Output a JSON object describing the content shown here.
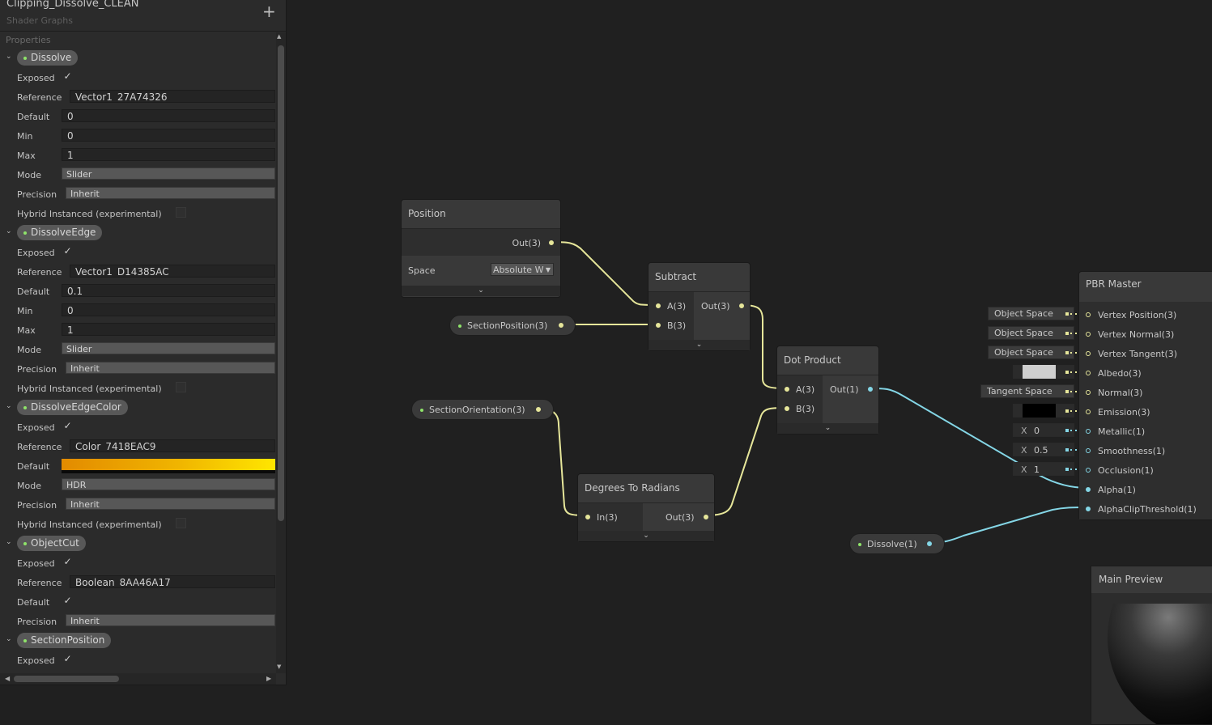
{
  "blackboard": {
    "title": "Clipping_Dissolve_CLEAN",
    "subtitle": "Shader Graphs",
    "add_label": "+",
    "properties_label": "Properties",
    "properties": [
      {
        "name": "Dissolve",
        "rows": [
          {
            "label": "Exposed",
            "kind": "check",
            "value": "✓"
          },
          {
            "label": "Reference",
            "kind": "field-indent",
            "value": "Vector1_27A74326"
          },
          {
            "label": "Default",
            "kind": "field",
            "value": "0"
          },
          {
            "label": "Min",
            "kind": "field",
            "value": "0"
          },
          {
            "label": "Max",
            "kind": "field",
            "value": "1"
          },
          {
            "label": "Mode",
            "kind": "drop",
            "value": "Slider"
          },
          {
            "label": "Precision",
            "kind": "drop-indent",
            "value": "Inherit"
          },
          {
            "label": "Hybrid Instanced (experimental)",
            "kind": "check-empty",
            "value": ""
          }
        ]
      },
      {
        "name": "DissolveEdge",
        "rows": [
          {
            "label": "Exposed",
            "kind": "check",
            "value": "✓"
          },
          {
            "label": "Reference",
            "kind": "field-indent",
            "value": "Vector1_D14385AC"
          },
          {
            "label": "Default",
            "kind": "field",
            "value": "0.1"
          },
          {
            "label": "Min",
            "kind": "field",
            "value": "0"
          },
          {
            "label": "Max",
            "kind": "field",
            "value": "1"
          },
          {
            "label": "Mode",
            "kind": "drop",
            "value": "Slider"
          },
          {
            "label": "Precision",
            "kind": "drop-indent",
            "value": "Inherit"
          },
          {
            "label": "Hybrid Instanced (experimental)",
            "kind": "check-empty",
            "value": ""
          }
        ]
      },
      {
        "name": "DissolveEdgeColor",
        "rows": [
          {
            "label": "Exposed",
            "kind": "check",
            "value": "✓"
          },
          {
            "label": "Reference",
            "kind": "field-indent",
            "value": "Color_7418EAC9"
          },
          {
            "label": "Default",
            "kind": "gradient",
            "value": ""
          },
          {
            "label": "Mode",
            "kind": "drop",
            "value": "HDR"
          },
          {
            "label": "Precision",
            "kind": "drop-indent",
            "value": "Inherit"
          },
          {
            "label": "Hybrid Instanced (experimental)",
            "kind": "check-empty",
            "value": ""
          }
        ]
      },
      {
        "name": "ObjectCut",
        "rows": [
          {
            "label": "Exposed",
            "kind": "check",
            "value": "✓"
          },
          {
            "label": "Reference",
            "kind": "field-indent",
            "value": "Boolean_8AA46A17"
          },
          {
            "label": "Default",
            "kind": "check",
            "value": "✓"
          },
          {
            "label": "Precision",
            "kind": "drop-indent",
            "value": "Inherit"
          }
        ]
      },
      {
        "name": "SectionPosition",
        "rows": [
          {
            "label": "Exposed",
            "kind": "check",
            "value": "✓"
          }
        ]
      }
    ]
  },
  "nodes": {
    "position": {
      "title": "Position",
      "out": "Out(3)",
      "space_label": "Space",
      "space_value": "Absolute W"
    },
    "subtract": {
      "title": "Subtract",
      "a": "A(3)",
      "b": "B(3)",
      "out": "Out(3)"
    },
    "dot_product": {
      "title": "Dot Product",
      "a": "A(3)",
      "b": "B(3)",
      "out": "Out(1)"
    },
    "deg2rad": {
      "title": "Degrees To Radians",
      "in": "In(3)",
      "out": "Out(3)"
    },
    "section_position": {
      "label": "SectionPosition(3)"
    },
    "section_orientation": {
      "label": "SectionOrientation(3)"
    },
    "dissolve": {
      "label": "Dissolve(1)"
    }
  },
  "pbr_master": {
    "title": "PBR Master",
    "ports": [
      "Vertex Position(3)",
      "Vertex Normal(3)",
      "Vertex Tangent(3)",
      "Albedo(3)",
      "Normal(3)",
      "Emission(3)",
      "Metallic(1)",
      "Smoothness(1)",
      "Occlusion(1)",
      "Alpha(1)",
      "AlphaClipThreshold(1)"
    ],
    "controls": {
      "vertex_position": "Object Space",
      "vertex_normal": "Object Space",
      "vertex_tangent": "Object Space",
      "normal": "Tangent Space",
      "axis_label": "X",
      "metallic": "0",
      "smoothness": "0.5",
      "occlusion": "1"
    },
    "colors": {
      "albedo": "#cfcfcf",
      "emission": "#000000"
    }
  },
  "preview": {
    "title": "Main Preview"
  },
  "colors": {
    "vector3_wire": "#e6e69a",
    "vector1_wire": "#84d6e6",
    "property_dot": "#8fe46a"
  }
}
